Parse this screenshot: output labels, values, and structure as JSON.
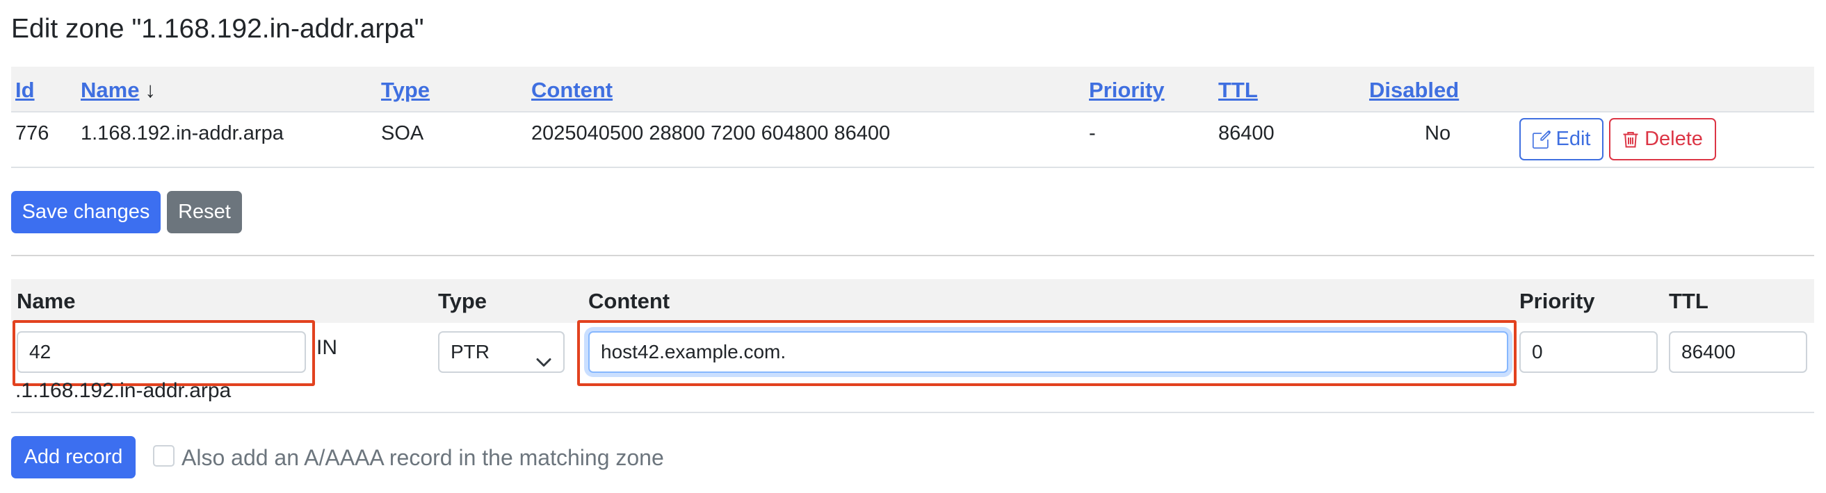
{
  "page": {
    "title": "Edit zone \"1.168.192.in-addr.arpa\""
  },
  "records_table": {
    "headers": {
      "id": "Id",
      "name": "Name",
      "sort_arrow": "↓",
      "type": "Type",
      "content": "Content",
      "priority": "Priority",
      "ttl": "TTL",
      "disabled": "Disabled"
    },
    "rows": [
      {
        "id": "776",
        "name": "1.168.192.in-addr.arpa",
        "type": "SOA",
        "content": "2025040500 28800 7200 604800 86400",
        "priority": "-",
        "ttl": "86400",
        "disabled": "No",
        "edit_label": "Edit",
        "delete_label": "Delete"
      }
    ]
  },
  "actions": {
    "save_label": "Save changes",
    "reset_label": "Reset"
  },
  "add_form": {
    "headers": {
      "name": "Name",
      "type": "Type",
      "content": "Content",
      "priority": "Priority",
      "ttl": "TTL"
    },
    "name_value": "42",
    "in_label": "IN",
    "zone_suffix": ".1.168.192.in-addr.arpa",
    "type_selected": "PTR",
    "content_value": "host42.example.com.",
    "priority_value": "0",
    "ttl_value": "86400",
    "add_label": "Add record",
    "also_add_label": "Also add an A/AAAA record in the matching zone",
    "also_add_checked": false
  },
  "colors": {
    "link": "#3f6fe0",
    "primary": "#3c6ff0",
    "secondary": "#6c757d",
    "danger": "#dc3545",
    "highlight": "#e2421f"
  },
  "icons": {
    "edit": "pencil-square-icon",
    "delete": "trash-icon",
    "sort": "arrow-down-icon",
    "select": "chevron-down-icon"
  }
}
